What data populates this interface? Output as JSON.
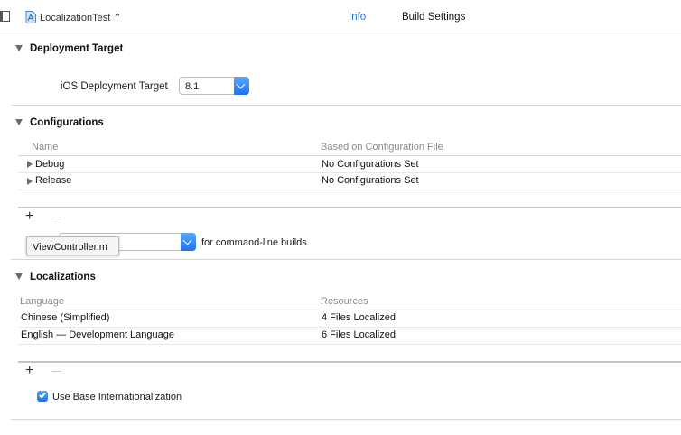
{
  "header": {
    "project_name": "LocalizationTest ⌃",
    "tabs": [
      {
        "label": "Info",
        "selected": true
      },
      {
        "label": "Build Settings",
        "selected": false
      }
    ]
  },
  "deployment_target": {
    "title": "Deployment Target",
    "ios_label": "iOS Deployment Target",
    "ios_value": "8.1"
  },
  "configurations": {
    "title": "Configurations",
    "columns": [
      "Name",
      "Based on Configuration File"
    ],
    "rows": [
      {
        "name": "Debug",
        "file": "No Configurations Set"
      },
      {
        "name": "Release",
        "file": "No Configurations Set"
      }
    ],
    "add_label": "+",
    "cmdline_label": "for command-line builds",
    "tooltip": "ViewController.m"
  },
  "localizations": {
    "title": "Localizations",
    "columns": [
      "Language",
      "Resources"
    ],
    "rows": [
      {
        "language": "Chinese (Simplified)",
        "resources": "4 Files Localized"
      },
      {
        "language": "English — Development Language",
        "resources": "6 Files Localized"
      }
    ],
    "add_label": "+",
    "use_base_label": "Use Base Internationalization",
    "use_base_checked": true
  },
  "colors": {
    "accent": "#1e72d6",
    "selected_tab": "#1e72d6"
  },
  "icons": [
    "sidebar-toggle-icon",
    "project-file-icon",
    "disclosure-triangle-icon",
    "chevron-icon",
    "checkmark-icon"
  ]
}
